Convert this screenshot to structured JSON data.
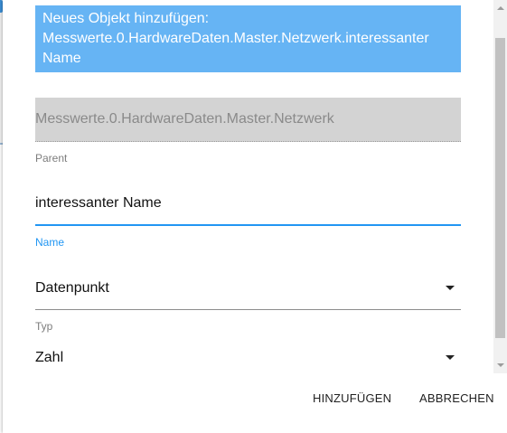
{
  "dialog": {
    "title_line1": "Neues Objekt hinzufügen:",
    "title_line2": "Messwerte.0.HardwareDaten.Master.Netzwerk.interessanter",
    "title_line3": "Name"
  },
  "fields": {
    "parent": {
      "value": "Messwerte.0.HardwareDaten.Master.Netzwerk",
      "label": "Parent"
    },
    "name": {
      "value": "interessanter Name",
      "label": "Name"
    },
    "type": {
      "value": "Datenpunkt",
      "label": "Typ"
    },
    "datatype": {
      "value": "Zahl"
    }
  },
  "actions": {
    "add_label": "HINZUFÜGEN",
    "cancel_label": "ABBRECHEN"
  },
  "colors": {
    "title_background": "#66b4f4",
    "accent": "#2196f3",
    "disabled_field": "#d3d3d3"
  },
  "icons": {
    "dropdown": "caret-down-icon",
    "scroll_up": "triangle-up-icon",
    "scroll_down": "triangle-down-icon"
  }
}
